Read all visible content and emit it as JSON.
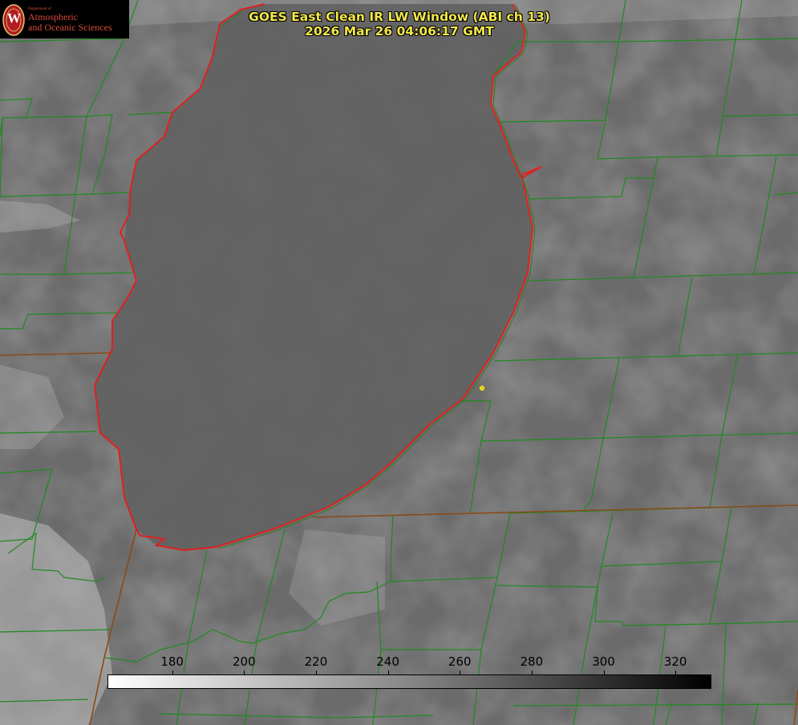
{
  "logo": {
    "dept": "Department of",
    "line1": "Atmospheric",
    "line2": "and Oceanic Sciences",
    "seal_letter": "W",
    "seal_color": "#b01e24"
  },
  "title": {
    "line1": "GOES East Clean IR LW Window (ABI ch 13)",
    "line2": "2026 Mar 26 04:06:17 GMT"
  },
  "colorbar": {
    "ticks": [
      "180",
      "200",
      "220",
      "240",
      "260",
      "280",
      "300",
      "320"
    ],
    "range": [
      162,
      330
    ],
    "gradient": [
      "#ffffff",
      "#000000"
    ]
  },
  "colors": {
    "county_lines": "#1f8a1f",
    "state_lines": "#8a4a1a",
    "shoreline": "#e02020",
    "marker": "#e6d31a",
    "title_text": "#f2e74a"
  },
  "marker": {
    "icon": "location-dot-icon"
  }
}
